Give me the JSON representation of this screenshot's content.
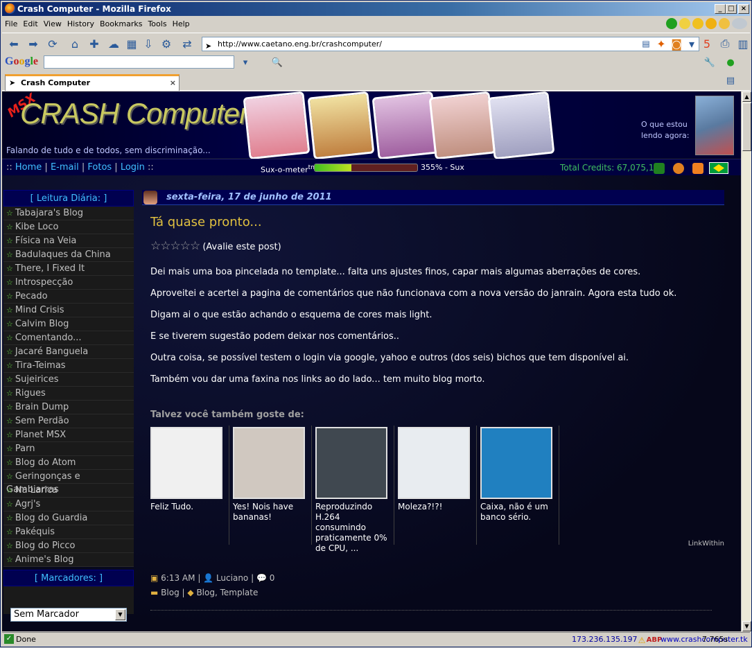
{
  "window": {
    "title": "Crash Computer - Mozilla Firefox"
  },
  "menu": [
    "File",
    "Edit",
    "View",
    "History",
    "Bookmarks",
    "Tools",
    "Help"
  ],
  "address": {
    "url": "http://www.caetano.eng.br/crashcomputer/"
  },
  "google": {
    "logo": "Google",
    "query": ""
  },
  "tab": {
    "label": "Crash Computer"
  },
  "banner": {
    "logo_mark": "MSX",
    "logo": "CRASH Computer",
    "tagline": "Falando de tudo e de todos, sem discriminação...",
    "reading_line1": "O que estou",
    "reading_line2": "lendo agora:"
  },
  "nav": {
    "links": [
      "Home",
      "E-mail",
      "Fotos",
      "Login"
    ],
    "sux_label": "Sux-o-meter",
    "sux_sup": "tm",
    "sux_value": "355% - Sux",
    "sux_fill": 0.36,
    "credits": "Total Credits: 67,075,18"
  },
  "sidebar": {
    "daily_heading": "[ Leitura Diária: ]",
    "daily_items": [
      "Tabajara's Blog",
      "Kibe Loco",
      "Física na Veia",
      "Badulaques da China",
      "There, I Fixed It",
      "Introspecção",
      "Pecado",
      "Mind Crisis",
      "Calvim Blog",
      "Comentando...",
      "Jacaré Banguela",
      "Tira-Teimas",
      "Sujeirices",
      "Rigues",
      "Brain Dump",
      "Sem Perdão",
      "Planet MSX",
      "Parn",
      "Blog do Atom",
      "Geringonças e Gambiarras",
      "Na Larica",
      "Agrj's",
      "Blog do Guardia",
      "Pakéquis",
      "Blog do Picco",
      "Anime's Blog"
    ],
    "markers_heading": "[ Marcadores: ]",
    "markers_select": "Sem Marcador"
  },
  "post": {
    "date": "sexta-feira, 17 de junho de 2011",
    "title": "Tá quase pronto...",
    "rating_text": "(Avalie este post)",
    "paragraphs": [
      "Dei mais uma boa pincelada no template... falta uns ajustes finos, capar mais algumas aberrações de cores.",
      "Aproveitei e acertei a pagina de comentários que não funcionava com a nova versão do janrain. Agora esta tudo ok.",
      "Digam ai o que estão achando o esquema de cores mais light.",
      "E se tiverem sugestão podem deixar nos comentários..",
      "Outra coisa, se possível testem o login via google, yahoo e outros (dos seis) bichos que tem disponível ai.",
      "Também vou dar uma faxina nos links ao do lado... tem muito blog morto."
    ],
    "related_heading": "Talvez você também goste de:",
    "related": [
      {
        "caption": "Feliz Tudo.",
        "color": "#f0f0f0"
      },
      {
        "caption": "Yes! Nois have bananas!",
        "color": "#d0c8c0"
      },
      {
        "caption": "Reproduzindo H.264 consumindo praticamente 0% de CPU, ...",
        "color": "#404850"
      },
      {
        "caption": "Moleza?!?!",
        "color": "#e8ecf0"
      },
      {
        "caption": "Caixa, não é um banco sério.",
        "color": "#2080c0"
      }
    ],
    "linkwithin": "LinkWithin",
    "time": "6:13 AM",
    "author": "Luciano",
    "comments": "0",
    "category": "Blog",
    "tags": "Blog, Template"
  },
  "status": {
    "text": "Done",
    "ip": "173.236.135.197",
    "site": "www.crashcomputer.tk",
    "timer": "7.765s"
  }
}
